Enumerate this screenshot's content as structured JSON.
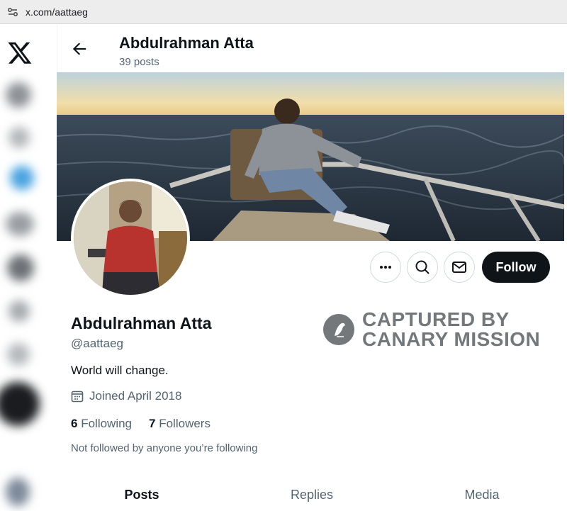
{
  "browser": {
    "url": "x.com/aattaeg"
  },
  "nav": {
    "logo_icon": "x-logo-icon"
  },
  "header": {
    "name": "Abdulrahman Atta",
    "posts": "39 posts"
  },
  "profile": {
    "name": "Abdulrahman Atta",
    "handle": "@aattaeg",
    "bio": "World will change.",
    "joined": "Joined April 2018",
    "following_count": "6",
    "following_label": "Following",
    "followers_count": "7",
    "followers_label": "Followers",
    "note": "Not followed by anyone you’re following"
  },
  "actions": {
    "follow_label": "Follow",
    "more_icon": "more-icon",
    "search_icon": "search-icon",
    "message_icon": "mail-icon"
  },
  "watermark": {
    "line1": "CAPTURED BY",
    "line2": "CANARY MISSION"
  },
  "tabs": [
    {
      "label": "Posts"
    },
    {
      "label": "Replies"
    },
    {
      "label": "Media"
    }
  ],
  "colors": {
    "follow_bg": "#0f1419",
    "secondary_text": "#536471",
    "border": "#cfd9de"
  }
}
